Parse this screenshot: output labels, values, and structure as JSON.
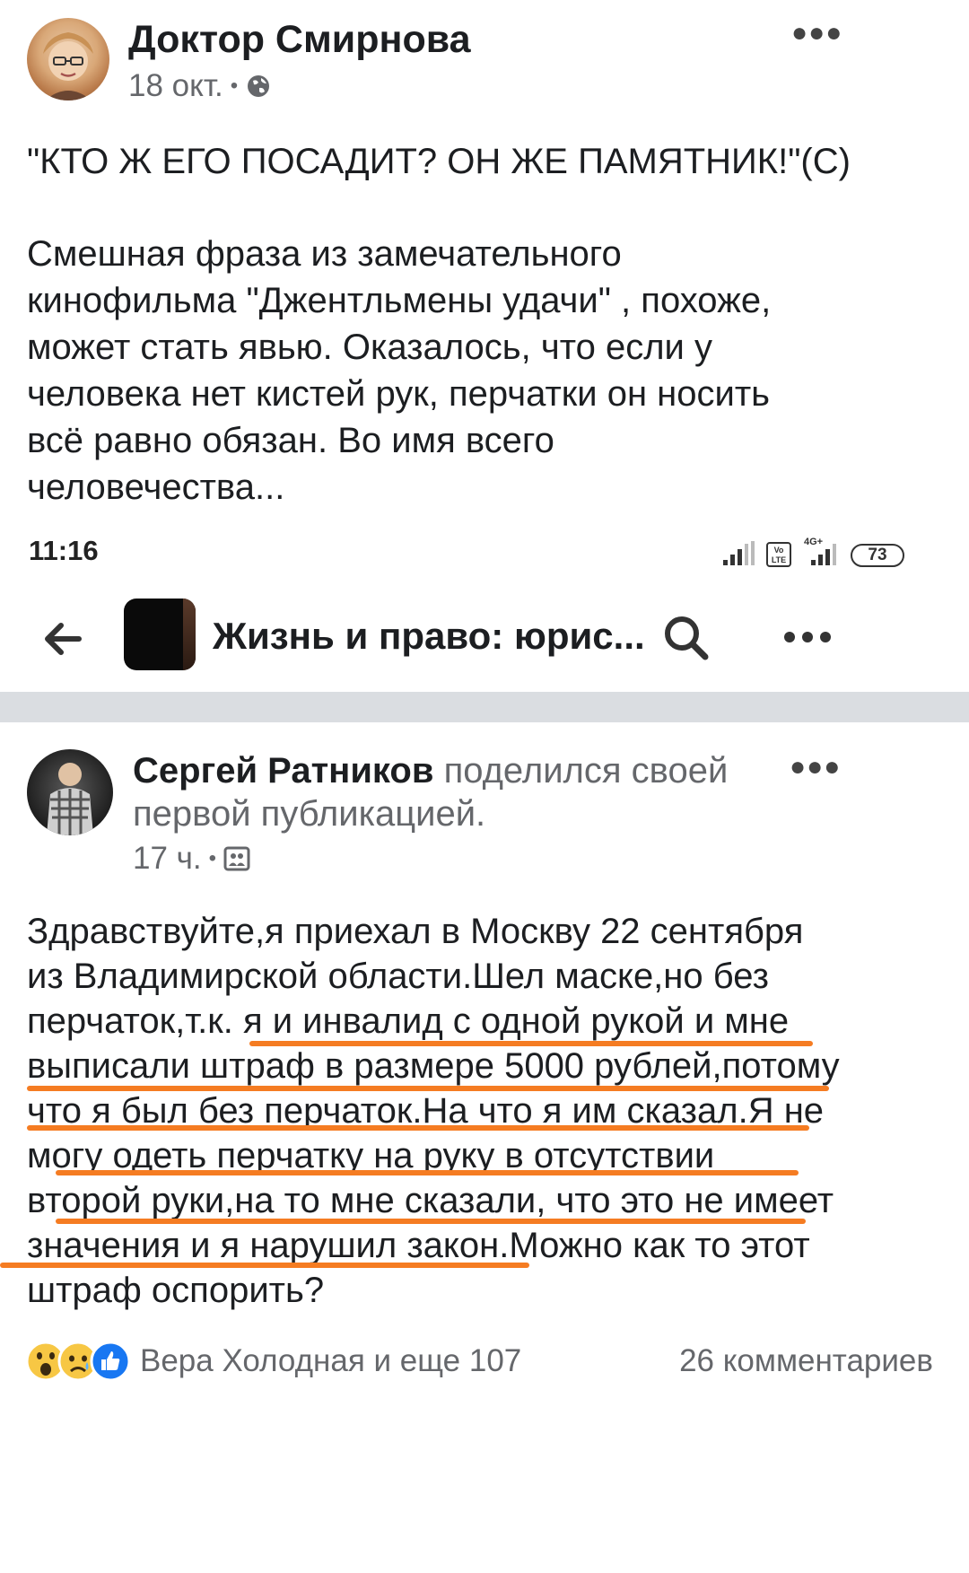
{
  "post1": {
    "author": "Доктор Смирнова",
    "time": "18 окт.",
    "separator": "•",
    "headline": "\"КТО Ж ЕГО ПОСАДИТ? ОН ЖЕ ПАМЯТНИК!\"(С)",
    "body_lines": [
      "Смешная фраза из замечательного",
      "кинофильма \"Джентльмены удачи\" , похоже,",
      "может стать явью. Оказалось, что если у",
      "человека нет кистей рук, перчатки он носить",
      "всё равно обязан. Во имя всего",
      "человечества..."
    ]
  },
  "screenshot": {
    "status_time": "11:16",
    "battery": "73",
    "volte_label": "Vo LTE",
    "network_label": "4G+",
    "group_title": "Жизнь и право: юрис...",
    "back_icon": "arrow-left-icon",
    "search_icon": "search-icon",
    "more_icon": "more-icon"
  },
  "post2": {
    "author": "Сергей Ратников",
    "action_line1": "поделился своей",
    "action_line2": "первой публикацией.",
    "time": "17 ч.",
    "separator": "•",
    "body_lines": [
      "Здравствуйте,я приехал в Москву 22 сентября",
      "из Владимирской области.Шел маске,но без",
      "перчаток,т.к. я и инвалид с одной рукой и мне",
      "выписали штраф в размере 5000 рублей,потому",
      "что я был без перчаток.На что я им сказал.Я не",
      "могу одеть перчатку на руку в отсутствии",
      "второй руки,на то мне сказали, что это не имеет",
      "значения и я нарушил закон.Можно как то этот",
      "штраф оспорить?"
    ],
    "reactions_text": "Вера Холодная и еще 107",
    "comments_text": "26 комментариев"
  },
  "colors": {
    "highlight": "#f57c22",
    "meta_gray": "#65676b",
    "divider": "#dadde1",
    "like_blue": "#1877f2"
  }
}
